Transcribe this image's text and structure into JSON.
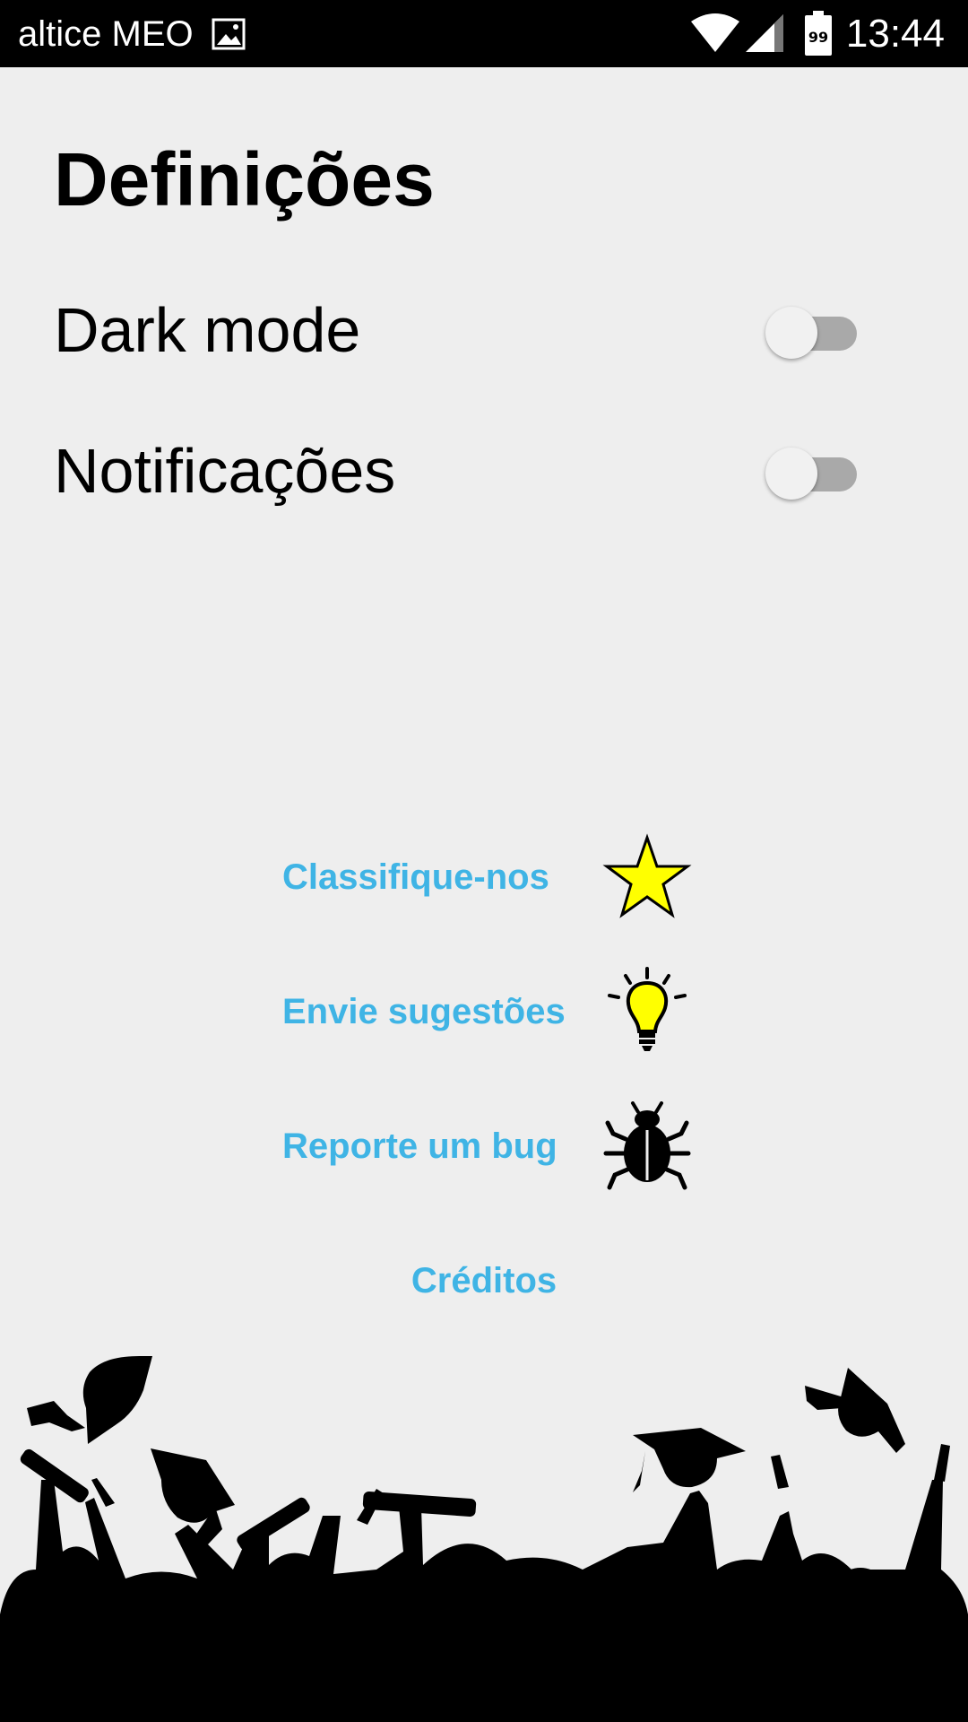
{
  "status_bar": {
    "carrier": "altice MEO",
    "battery_level": "99",
    "time": "13:44"
  },
  "page": {
    "title": "Definições"
  },
  "settings": [
    {
      "label": "Dark mode",
      "enabled": false
    },
    {
      "label": "Notificações",
      "enabled": false
    }
  ],
  "links": [
    {
      "label": "Classifique-nos",
      "icon": "star-icon"
    },
    {
      "label": "Envie sugestões",
      "icon": "lightbulb-icon"
    },
    {
      "label": "Reporte um bug",
      "icon": "bug-icon"
    }
  ],
  "credits_label": "Créditos",
  "colors": {
    "link": "#3fb4e5",
    "background": "#eeeeee",
    "star": "#ffff00",
    "bulb": "#ffff00"
  },
  "illustration": "graduation-crowd-silhouette"
}
